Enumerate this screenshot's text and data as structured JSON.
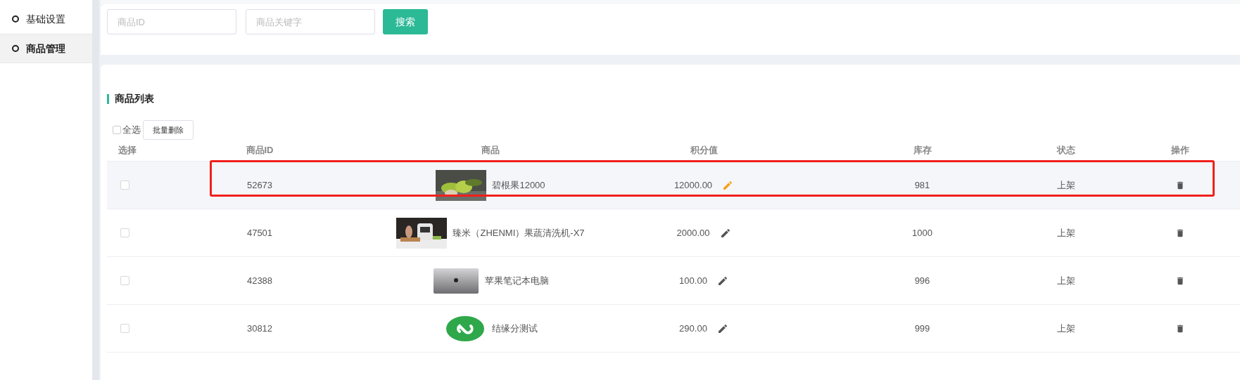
{
  "sidebar": {
    "items": [
      {
        "label": "基础设置",
        "selected": false
      },
      {
        "label": "商品管理",
        "selected": true
      }
    ]
  },
  "search": {
    "fields": [
      {
        "placeholder": "商品ID"
      },
      {
        "placeholder": "商品关键字"
      }
    ],
    "button": "搜索"
  },
  "list": {
    "title": "商品列表",
    "select_all": {
      "label": "全选",
      "checked": false
    },
    "batch_delete": "批量删除",
    "columns": [
      "选择",
      "商品ID",
      "商品",
      "积分值",
      "库存",
      "状态",
      "操作"
    ],
    "rows": [
      {
        "checked": false,
        "highlighted": true,
        "id": "52673",
        "kind": "fruit",
        "name": "碧根果12000",
        "points": "12000.00",
        "stock": "981",
        "status": "上架"
      },
      {
        "checked": false,
        "highlighted": false,
        "id": "47501",
        "kind": "kitchen",
        "name": "臻米（ZHENMI）果蔬清洗机-X7",
        "points": "2000.00",
        "stock": "1000",
        "status": "上架"
      },
      {
        "checked": false,
        "highlighted": false,
        "id": "42388",
        "kind": "laptop",
        "name": "苹果笔记本电脑",
        "points": "100.00",
        "stock": "996",
        "status": "上架"
      },
      {
        "checked": false,
        "highlighted": false,
        "id": "30812",
        "kind": "logo",
        "name": "结缘分测试",
        "points": "290.00",
        "stock": "999",
        "status": "上架"
      }
    ]
  }
}
